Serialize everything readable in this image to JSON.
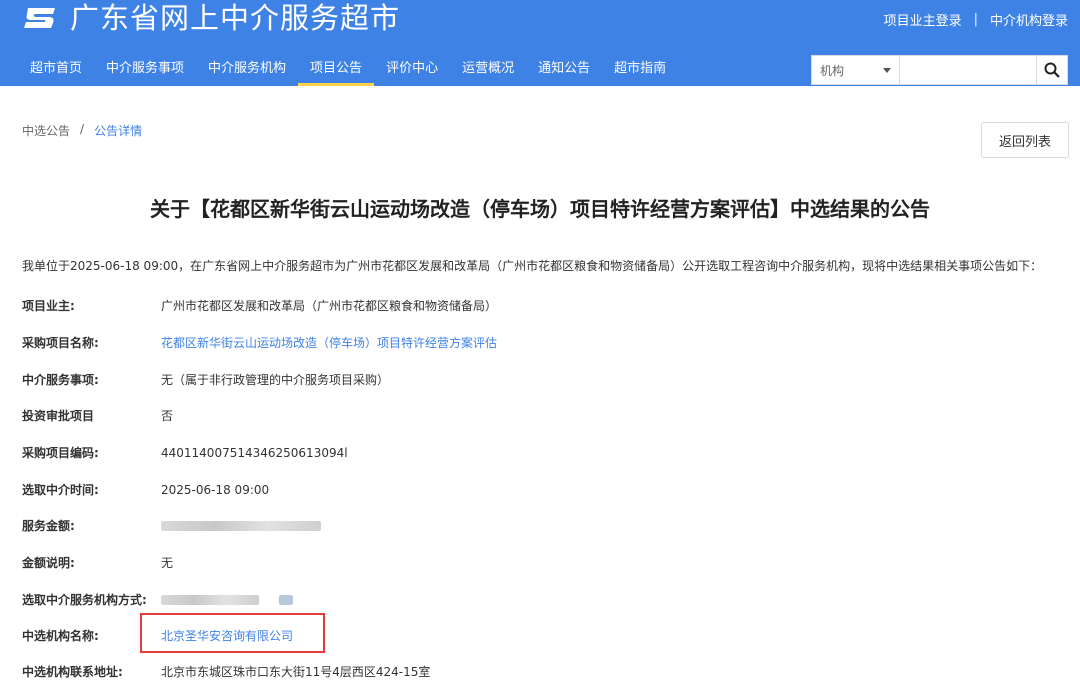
{
  "header": {
    "site_title": "广东省网上中介服务超市",
    "owner_login": "项目业主登录",
    "separator": "|",
    "agency_login": "中介机构登录",
    "nav": [
      {
        "label": "超市首页"
      },
      {
        "label": "中介服务事项"
      },
      {
        "label": "中介服务机构"
      },
      {
        "label": "项目公告",
        "active": true
      },
      {
        "label": "评价中心"
      },
      {
        "label": "运营概况"
      },
      {
        "label": "通知公告"
      },
      {
        "label": "超市指南"
      }
    ],
    "search": {
      "select_value": "机构",
      "placeholder": ""
    }
  },
  "breadcrumb": {
    "parent": "中选公告",
    "sep": "/",
    "current": "公告详情"
  },
  "back_label": "返回列表",
  "announcement": {
    "title": "关于【花都区新华街云山运动场改造（停车场）项目特许经营方案评估】中选结果的公告",
    "intro": "我单位于2025-06-18 09:00，在广东省网上中介服务超市为广州市花都区发展和改革局（广州市花都区粮食和物资储备局）公开选取工程咨询中介服务机构，现将中选结果相关事项公告如下：",
    "fields": [
      {
        "label": "项目业主:",
        "value": "广州市花都区发展和改革局（广州市花都区粮食和物资储备局）"
      },
      {
        "label": "采购项目名称:",
        "value": "花都区新华街云山运动场改造（停车场）项目特许经营方案评估"
      },
      {
        "label": "中介服务事项:",
        "value": "无（属于非行政管理的中介服务项目采购）"
      },
      {
        "label": "投资审批项目",
        "value": "否"
      },
      {
        "label": "采购项目编码:",
        "value": "440114007514346250613094l"
      },
      {
        "label": "选取中介时间:",
        "value": "2025-06-18 09:00"
      },
      {
        "label": "服务金额:",
        "value": ""
      },
      {
        "label": "金额说明:",
        "value": "无"
      },
      {
        "label": "选取中介服务机构方式:",
        "value": ""
      },
      {
        "label": "中选机构名称:",
        "value": "北京圣华安咨询有限公司"
      },
      {
        "label": "中选机构联系地址:",
        "value": "北京市东城区珠市口东大街11号4层西区424-15室"
      }
    ]
  },
  "colors": {
    "primary": "#3f82e6",
    "nav_active": "#ffd24a",
    "highlight": "#e83a3a"
  }
}
